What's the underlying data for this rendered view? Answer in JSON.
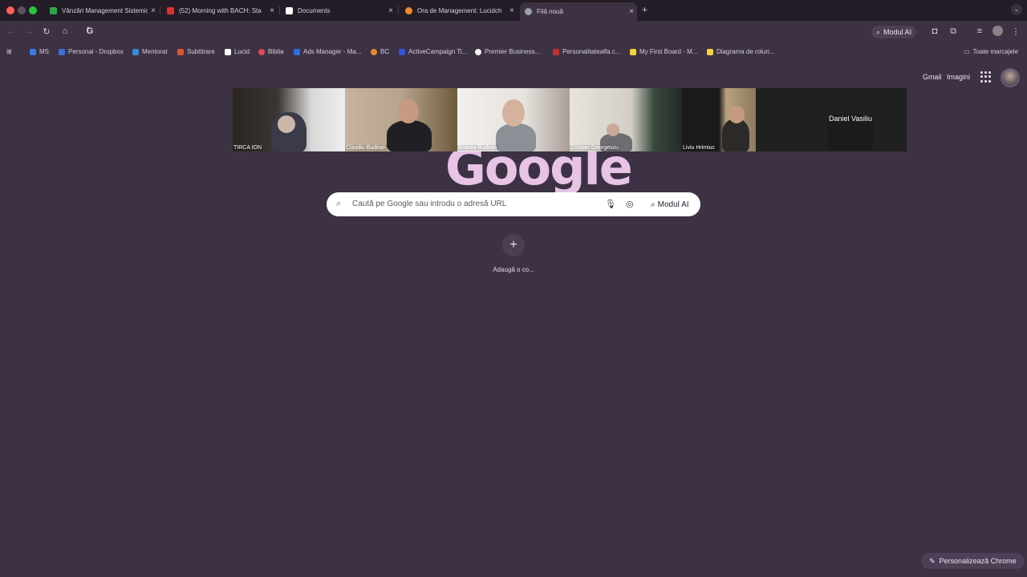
{
  "tabs": [
    {
      "title": "Vânzări Management Sistemic",
      "favicon_color": "#2fa44f"
    },
    {
      "title": "(52) Morning with BACH: Sta",
      "favicon_color": "#e0302a"
    },
    {
      "title": "Documents",
      "favicon_color": "#ffffff"
    },
    {
      "title": "Ora de Management: Lucidch",
      "favicon_color": "#f08a2a"
    },
    {
      "title": "Filă nouă",
      "favicon_color": "#9aa0a6"
    }
  ],
  "close_glyph": "×",
  "new_tab_glyph": "+",
  "tab_search_glyph": "⌄",
  "toolbar": {
    "omnibox_text": "f",
    "modul_ai_label": "Modul AI"
  },
  "bookmarks": [
    {
      "label": "MS",
      "icon_color": "#3b7be0"
    },
    {
      "label": "Personal - Dropbox",
      "icon_color": "#3d6fd9"
    },
    {
      "label": "Mentorat",
      "icon_color": "#3b8bd8"
    },
    {
      "label": "Subtitrare",
      "icon_color": "#e2542c"
    },
    {
      "label": "Lucid",
      "icon_color": "#ffffff"
    },
    {
      "label": "Biblia",
      "icon_color": "#e04a5a"
    },
    {
      "label": "Ads Manager - Ma...",
      "icon_color": "#2d6ee8"
    },
    {
      "label": "BC",
      "icon_color": "#e58a2c"
    },
    {
      "label": "ActiveCampaign Ti...",
      "icon_color": "#3553d6"
    },
    {
      "label": "Premier Business...",
      "icon_color": "#f1f1f1"
    },
    {
      "label": "Personalitatealfa.c...",
      "icon_color": "#c4302b"
    },
    {
      "label": "My First Board - M...",
      "icon_color": "#f4d23c"
    },
    {
      "label": "Diagrama de roluri...",
      "icon_color": "#f4d23c"
    }
  ],
  "all_bookmarks_label": "Toate marcajele",
  "header_links": {
    "gmail": "Gmail",
    "images": "Imagini"
  },
  "logo_text": "Google",
  "participants": [
    "TIRCA ION",
    "Claudiu Budean",
    "Andrea Budean",
    "Cristian Georgescu",
    "Liviu Hrimiuc",
    "Daniel Vasiliu"
  ],
  "search": {
    "placeholder": "Caută pe Google sau introdu o adresă URL",
    "ai_mode_label": "Modul AI"
  },
  "shortcut": {
    "add_label": "Adaugă o co...",
    "plus_glyph": "+"
  },
  "customize_label": "Personalizează Chrome",
  "colors": {
    "background": "#3c3243",
    "tabstrip": "#241d27",
    "accent": "#e7c3e6"
  }
}
